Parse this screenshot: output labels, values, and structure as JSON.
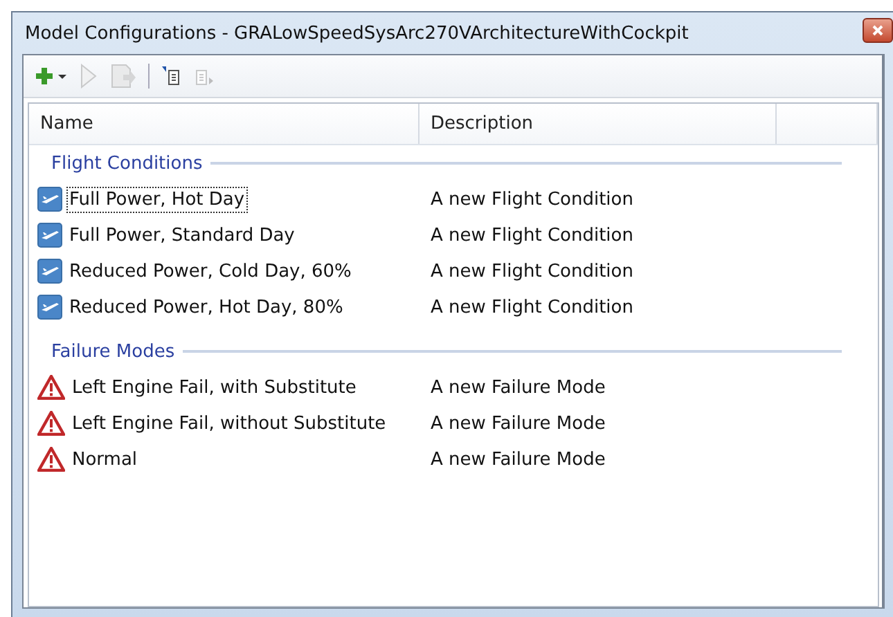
{
  "window": {
    "title": "Model Configurations - GRALowSpeedSysArc270VArchitectureWithCockpit"
  },
  "toolbar": [
    {
      "kind": "add",
      "disabled": false
    },
    {
      "kind": "run",
      "disabled": true
    },
    {
      "kind": "export",
      "disabled": true
    },
    {
      "kind": "separator"
    },
    {
      "kind": "move-in",
      "disabled": false
    },
    {
      "kind": "move-out",
      "disabled": true
    }
  ],
  "table": {
    "columns": [
      "Name",
      "Description"
    ],
    "groups": [
      {
        "title": "Flight Conditions",
        "kind": "flight",
        "rows": [
          {
            "name": "Full Power, Hot Day",
            "description": "A new Flight Condition",
            "focused": true
          },
          {
            "name": "Full Power, Standard Day",
            "description": "A new Flight Condition",
            "focused": false
          },
          {
            "name": "Reduced Power, Cold Day, 60%",
            "description": "A new Flight Condition",
            "focused": false
          },
          {
            "name": "Reduced Power, Hot Day, 80%",
            "description": "A new Flight Condition",
            "focused": false
          }
        ]
      },
      {
        "title": "Failure Modes",
        "kind": "failure",
        "rows": [
          {
            "name": "Left Engine Fail, with Substitute",
            "description": "A new Failure Mode",
            "focused": false
          },
          {
            "name": "Left Engine Fail, without Substitute",
            "description": "A new Failure Mode",
            "focused": false
          },
          {
            "name": "Normal",
            "description": "A new Failure Mode",
            "focused": false
          }
        ]
      }
    ]
  }
}
